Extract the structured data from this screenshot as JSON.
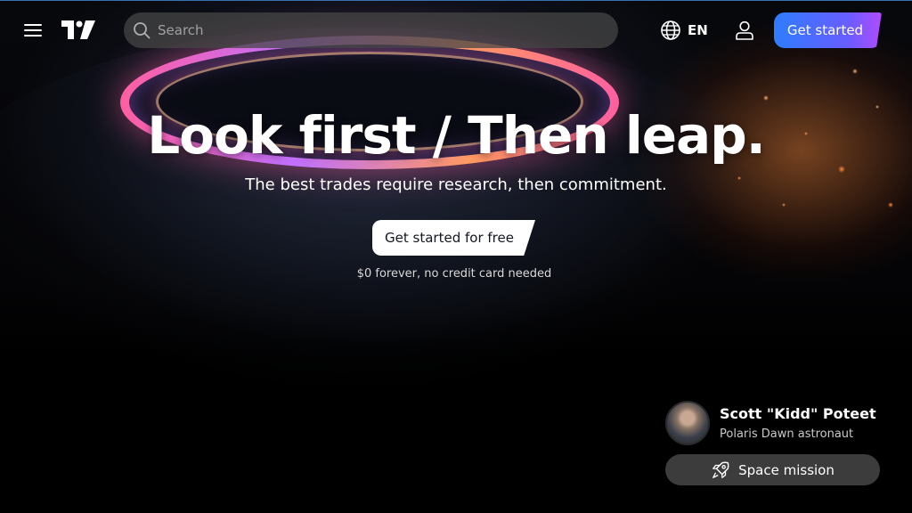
{
  "header": {
    "search_placeholder": "Search",
    "language": "EN",
    "get_started_label": "Get started",
    "accent_gradient": [
      "#2e7dff",
      "#6a5cff",
      "#b24bff"
    ]
  },
  "hero": {
    "headline": "Look first / Then leap.",
    "subheadline": "The best trades require research, then commitment.",
    "cta_label": "Get started for free",
    "cta_note": "$0 forever, no credit card needed"
  },
  "testimonial": {
    "name": "Scott \"Kidd\" Poteet",
    "role": "Polaris Dawn astronaut",
    "button_label": "Space mission"
  },
  "icons": [
    "menu-icon",
    "tradingview-logo",
    "search-icon",
    "globe-icon",
    "user-icon",
    "rocket-icon"
  ]
}
